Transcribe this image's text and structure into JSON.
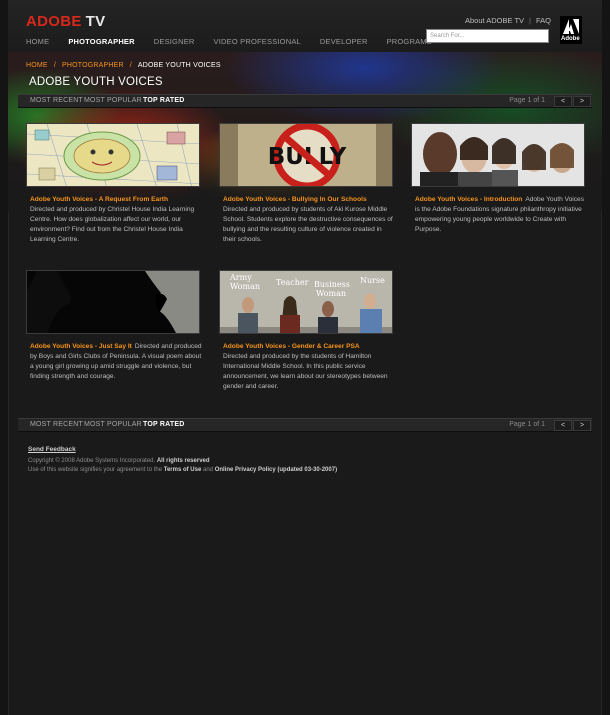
{
  "header": {
    "logo_brand": "ADOBE",
    "logo_product": "TV",
    "nav": [
      "HOME",
      "PHOTOGRAPHER",
      "DESIGNER",
      "VIDEO PROFESSIONAL",
      "DEVELOPER",
      "PROGRAMS"
    ],
    "active_nav": "PHOTOGRAPHER",
    "about_link": "About ADOBE TV",
    "link_separator": "|",
    "faq_link": "FAQ",
    "search_placeholder": "Search For...",
    "adobe_mark_text": "Adobe"
  },
  "breadcrumb": {
    "home": "HOME",
    "section": "PHOTOGRAPHER",
    "current": "ADOBE YOUTH VOICES",
    "separator": "/"
  },
  "page_title": "ADOBE YOUTH VOICES",
  "tabs": {
    "most_recent": "MOST RECENT",
    "most_popular": "MOST POPULAR",
    "top_rated": "TOP RATED",
    "active": "TOP RATED",
    "page_label": "Page 1 of 1",
    "prev": "<",
    "next": ">"
  },
  "videos": [
    {
      "title": "Adobe Youth Voices - A Request From Earth",
      "description": "Directed and produced by Christel House India Learning Centre. How does globalization affect our world, our environment? Find out from the Christel House India Learning Centre.",
      "thumb": "earth-drawing-thumbnail"
    },
    {
      "title": "Adobe Youth Voices - Bullying In Our Schools",
      "description": "Directed and produced by students of Aki Kurose Middle School. Students explore the destructive consequences of bullying and the resulting culture of violence created in their schools.",
      "thumb": "bully-sign-thumbnail",
      "thumb_text": "BULLY"
    },
    {
      "title": "Adobe Youth Voices - Introduction",
      "description": "Adobe Youth Voices is the Adobe Foundations signature philanthropy initiative empowering young people worldwide to Create with Purpose.",
      "thumb": "group-faces-thumbnail"
    },
    {
      "title": "Adobe Youth Voices - Just Say It",
      "description": "Directed and produced by Boys and Girls Clubs of Peninsula. A visual poem about a young girl growing up amid struggle and violence, but finding strength and courage.",
      "thumb": "silhouette-thumbnail"
    },
    {
      "title": "Adobe Youth Voices - Gender & Career PSA",
      "description": "Directed and produced by the students of Hamilton International Middle School. In this public service announcement, we learn about our stereotypes between gender and career.",
      "thumb": "career-labels-thumbnail",
      "thumb_labels": [
        "Army\nWoman",
        "Teacher",
        "Business\nWoman",
        "Nurse"
      ]
    }
  ],
  "footer": {
    "feedback": "Send Feedback",
    "copyright_prefix": "Copyright © 2008 Adobe Systems Incorporated.",
    "rights": "All rights reserved",
    "agreement_prefix": "Use of this website signifies your agreement to the",
    "terms": "Terms of Use",
    "and": "and",
    "privacy": "Online Privacy Policy (updated 03-30-2007)"
  },
  "colors": {
    "accent_orange": "#f7941d",
    "brand_red": "#d7291b",
    "background": "#1a1a1a"
  }
}
